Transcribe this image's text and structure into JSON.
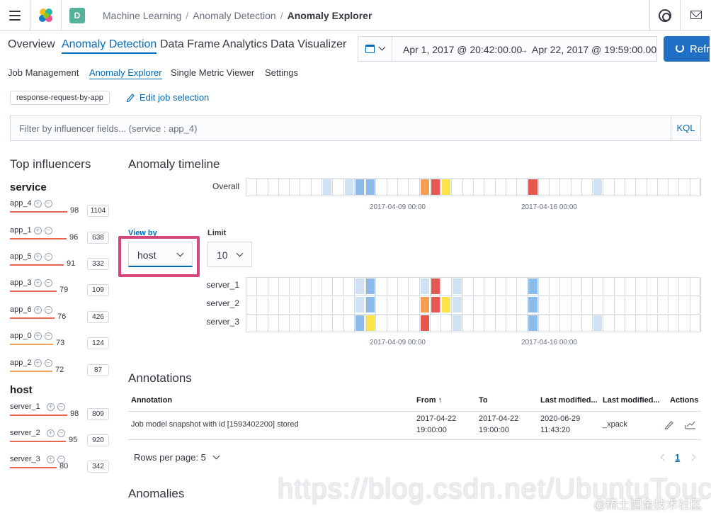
{
  "header": {
    "space_initial": "D",
    "breadcrumbs": [
      "Machine Learning",
      "Anomaly Detection",
      "Anomaly Explorer"
    ],
    "breadcrumb_sep": "/"
  },
  "main_tabs": [
    "Overview",
    "Anomaly Detection",
    "Data Frame Analytics",
    "Data Visualizer"
  ],
  "date_picker": {
    "start": "Apr 1, 2017 @ 20:42:00.00",
    "arrow": "→",
    "end": "Apr 22, 2017 @ 19:59:00.00"
  },
  "refresh_label": "Refresh",
  "sub_tabs": [
    "Job Management",
    "Anomaly Explorer",
    "Single Metric Viewer",
    "Settings"
  ],
  "job": {
    "id": "response-request-by-app",
    "edit_label": "Edit job selection"
  },
  "filter": {
    "placeholder": "Filter by influencer fields... (service : app_4)",
    "kql": "KQL"
  },
  "influencers": {
    "title": "Top influencers",
    "groups": [
      {
        "name": "service",
        "items": [
          {
            "name": "app_4",
            "score": "98",
            "count": "1104",
            "color": "#e7664c"
          },
          {
            "name": "app_1",
            "score": "96",
            "count": "638",
            "color": "#e7664c"
          },
          {
            "name": "app_5",
            "score": "91",
            "count": "332",
            "color": "#e7664c"
          },
          {
            "name": "app_3",
            "score": "79",
            "count": "109",
            "color": "#e7664c"
          },
          {
            "name": "app_6",
            "score": "76",
            "count": "426",
            "color": "#e7664c"
          },
          {
            "name": "app_0",
            "score": "73",
            "count": "124",
            "color": "#f5a35c"
          },
          {
            "name": "app_2",
            "score": "72",
            "count": "87",
            "color": "#f5a35c"
          }
        ]
      },
      {
        "name": "host",
        "items": [
          {
            "name": "server_1",
            "score": "98",
            "count": "809",
            "color": "#e7664c"
          },
          {
            "name": "server_2",
            "score": "95",
            "count": "920",
            "color": "#e7664c"
          },
          {
            "name": "server_3",
            "score": "80",
            "count": "342",
            "color": "#e7664c"
          }
        ]
      }
    ]
  },
  "timeline": {
    "title": "Anomaly timeline",
    "overall_label": "Overall",
    "ticks": [
      "2017-04-09 00:00",
      "2017-04-16 00:00"
    ],
    "view_by_label": "View by",
    "view_by_value": "host",
    "limit_label": "Limit",
    "limit_value": "10",
    "lanes": [
      "server_1",
      "server_2",
      "server_3"
    ]
  },
  "annotations": {
    "title": "Annotations",
    "columns": [
      "Annotation",
      "From",
      "To",
      "Last modified...",
      "Last modified...",
      "Actions"
    ],
    "rows": [
      {
        "annotation": "Job model snapshot with id [1593402200] stored",
        "from_date": "2017-04-22",
        "from_time": "19:00:00",
        "to_date": "2017-04-22",
        "to_time": "19:00:00",
        "modified_date": "2020-06-29",
        "modified_time": "11:43:20",
        "modified_by": "_xpack"
      }
    ],
    "rows_per_page": "Rows per page: 5",
    "page": "1"
  },
  "anomalies_title": "Anomalies",
  "watermark": "https://blog.csdn.net/UbuntuTouch",
  "watermark2": "@稀土掘金技术社区",
  "colors": {
    "blue_light": "#cfe1f3",
    "blue": "#8bbce9",
    "orange": "#f2a054",
    "red": "#e6574f",
    "yellow": "#fbe44a"
  }
}
